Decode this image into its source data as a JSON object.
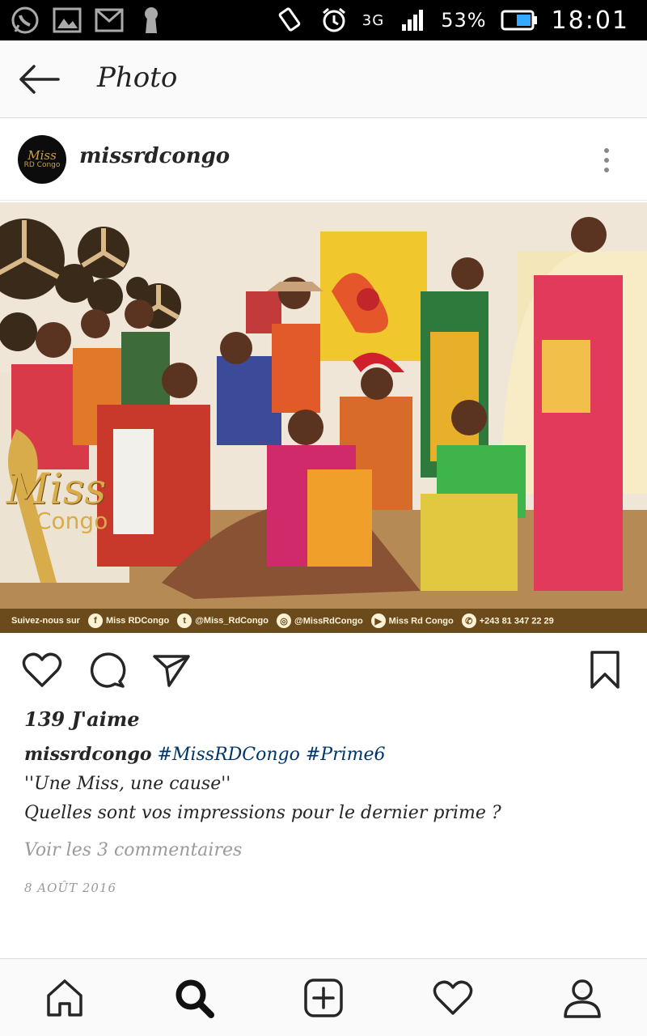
{
  "status_bar": {
    "network": "3G",
    "battery": "53%",
    "time": "18:01",
    "left_icons": [
      "whatsapp-icon",
      "image-icon",
      "gmail-icon",
      "keyhole-icon"
    ],
    "right_icons": [
      "rotate-icon",
      "alarm-icon",
      "signal-icon",
      "battery-icon"
    ]
  },
  "header": {
    "title": "Photo",
    "back_icon": "arrow-left-icon"
  },
  "post": {
    "username": "missrdcongo",
    "avatar_text_1": "Miss",
    "avatar_text_2": "RD Congo",
    "photo": {
      "watermark_1": "Miss",
      "watermark_2": "Congo",
      "footer": {
        "follow": "Suivez-nous sur",
        "facebook": "Miss RDCongo",
        "twitter": "@Miss_RdCongo",
        "instagram": "@MissRdCongo",
        "youtube": "Miss Rd Congo",
        "phone": "+243 81 347 22 29"
      }
    },
    "likes": "139 J'aime",
    "caption": {
      "user": "missrdcongo",
      "tag1": "#MissRDCongo",
      "tag2": "#Prime6",
      "line2": "''Une Miss, une cause''",
      "line3": "Quelles sont vos impressions pour le dernier prime ?"
    },
    "view_comments": "Voir les 3 commentaires",
    "date": "8 AOÛT 2016"
  },
  "bottom_nav": [
    "home-icon",
    "search-icon",
    "add-icon",
    "heart-icon",
    "profile-icon"
  ],
  "colors": {
    "hashtag": "#003569",
    "muted": "#9a9a9a",
    "text": "#262626",
    "footer_band": "#6b4a1c"
  }
}
